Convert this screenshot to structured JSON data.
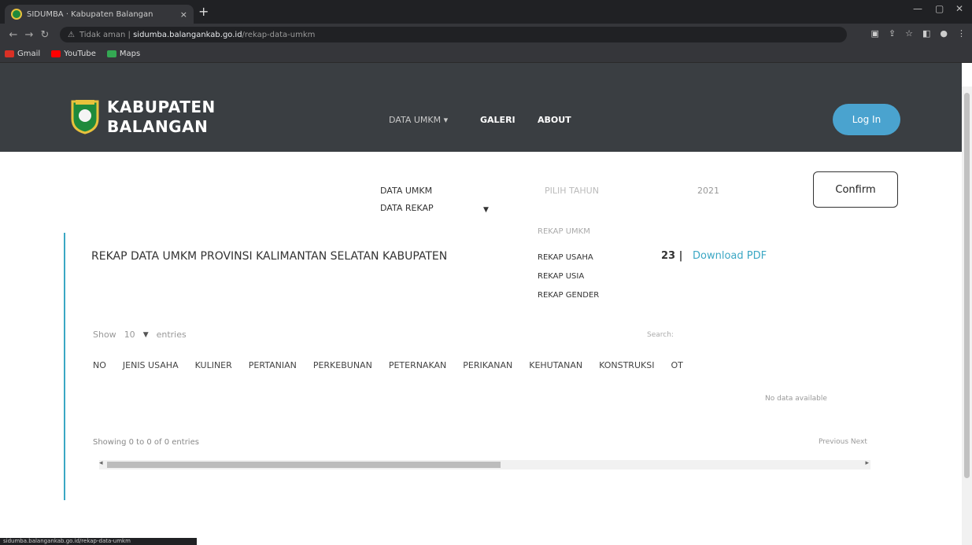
{
  "browser": {
    "tab_title": "SIDUMBA · Kabupaten Balangan",
    "tab_close": "×",
    "new_tab": "+",
    "url_scheme": "Tidak aman |",
    "url_host": "sidumba.balangankab.go.id",
    "url_path": "/rekap-data-umkm",
    "bookmarks": [
      {
        "label": "Gmail",
        "color": "#d93025"
      },
      {
        "label": "YouTube",
        "color": "#ff0000"
      },
      {
        "label": "Maps",
        "color": "#34a853"
      }
    ],
    "status_url": "sidumba.balangankab.go.id/rekap-data-umkm"
  },
  "header": {
    "brand_line1": "KABUPATEN",
    "brand_line2": "BALANGAN",
    "nav": {
      "data_umkm": "DATA UMKM ▾",
      "galeri": "GALERI",
      "about": "ABOUT"
    },
    "login": "Log In"
  },
  "filters": {
    "data_umkm": "DATA UMKM",
    "data_rekap": "DATA REKAP",
    "tahun_label": "PILIH TAHUN",
    "tahun_value": "2021",
    "confirm": "Confirm",
    "dropdown": [
      "REKAP UMKM",
      "REKAP USAHA",
      "REKAP USIA",
      "REKAP GENDER"
    ]
  },
  "card": {
    "title": "REKAP DATA UMKM PROVINSI KALIMANTAN SELATAN KABUPATEN",
    "count": "23 |",
    "download": "Download PDF",
    "show": "Show",
    "entries_value": "10",
    "entries": "entries",
    "search": "Search:",
    "columns": [
      "NO",
      "JENIS USAHA",
      "KULINER",
      "PERTANIAN",
      "PERKEBUNAN",
      "PETERNAKAN",
      "PERIKANAN",
      "KEHUTANAN",
      "KONSTRUKSI",
      "OT"
    ],
    "no_data": "No data available",
    "showing": "Showing 0 to 0 of 0 entries",
    "pager": "Previous  Next"
  },
  "colors": {
    "header_bg": "#3a3e42",
    "accent": "#3ba7c4",
    "login_bg": "#4aa3cf"
  }
}
